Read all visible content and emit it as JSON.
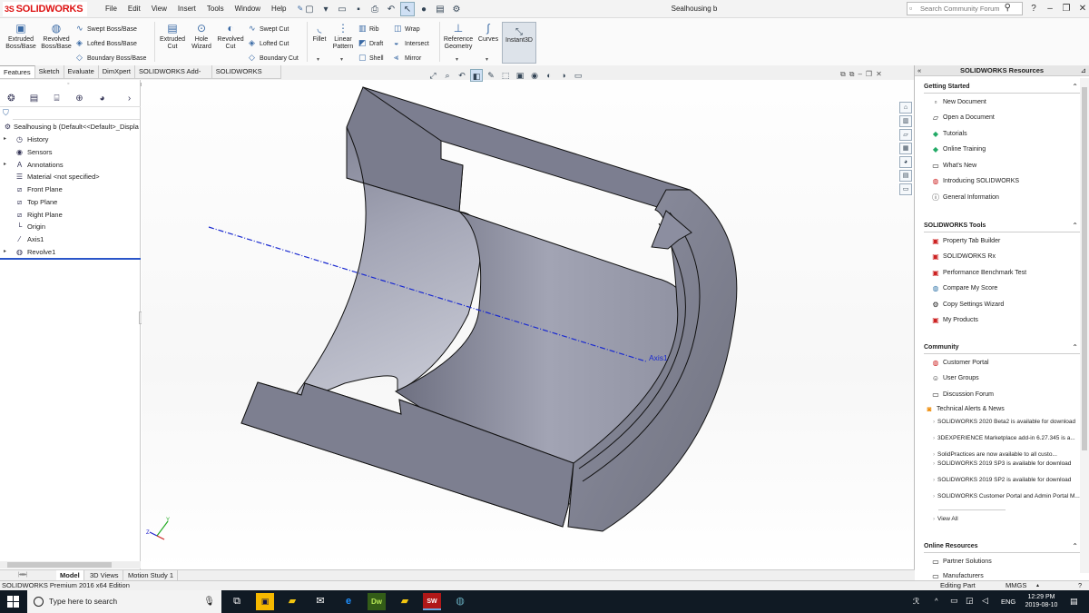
{
  "app": {
    "brand": "SOLIDWORKS",
    "document_title": "Sealhousing b",
    "menus": [
      "File",
      "Edit",
      "View",
      "Insert",
      "Tools",
      "Window",
      "Help"
    ],
    "search_placeholder": "Search Community Forum"
  },
  "ribbon": {
    "extruded_boss": "Extruded Boss/Base",
    "revolved_boss": "Revolved Boss/Base",
    "swept_boss": "Swept Boss/Base",
    "lofted_boss": "Lofted Boss/Base",
    "boundary_boss": "Boundary Boss/Base",
    "extruded_cut": "Extruded Cut",
    "hole_wizard": "Hole Wizard",
    "revolved_cut": "Revolved Cut",
    "swept_cut": "Swept Cut",
    "lofted_cut": "Lofted Cut",
    "boundary_cut": "Boundary Cut",
    "fillet": "Fillet",
    "linear_pattern": "Linear Pattern",
    "rib": "Rib",
    "draft": "Draft",
    "shell": "Shell",
    "wrap": "Wrap",
    "intersect": "Intersect",
    "mirror": "Mirror",
    "reference_geometry": "Reference Geometry",
    "curves": "Curves",
    "instant3d": "Instant3D"
  },
  "tabs": [
    "Features",
    "Sketch",
    "Evaluate",
    "DimXpert",
    "SOLIDWORKS Add-Ins",
    "SOLIDWORKS MBD"
  ],
  "tree": {
    "root": "Sealhousing b  (Default<<Default>_Displa",
    "items": [
      "History",
      "Sensors",
      "Annotations",
      "Material <not specified>",
      "Front Plane",
      "Top Plane",
      "Right Plane",
      "Origin",
      "Axis1",
      "Revolve1"
    ]
  },
  "viewport": {
    "axis_label": "Axis1"
  },
  "bottom_tabs": [
    "Model",
    "3D Views",
    "Motion Study 1"
  ],
  "status": {
    "edition": "SOLIDWORKS Premium 2016 x64 Edition",
    "mode": "Editing Part",
    "units": "MMGS"
  },
  "taskpane": {
    "title": "SOLIDWORKS Resources",
    "getting_started": {
      "title": "Getting Started",
      "items": [
        "New Document",
        "Open a Document",
        "Tutorials",
        "Online Training",
        "What's New",
        "Introducing SOLIDWORKS",
        "General Information"
      ]
    },
    "tools": {
      "title": "SOLIDWORKS Tools",
      "items": [
        "Property Tab Builder",
        "SOLIDWORKS Rx",
        "Performance Benchmark Test",
        "Compare My Score",
        "Copy Settings Wizard",
        "My Products"
      ]
    },
    "community": {
      "title": "Community",
      "items": [
        "Customer Portal",
        "User Groups",
        "Discussion Forum",
        "Technical Alerts & News"
      ]
    },
    "news": [
      "SOLIDWORKS 2020 Beta2 is available for download",
      "3DEXPERIENCE Marketplace add-in 6.27.345 is a...",
      "SolidPractices are now available to all custo...",
      "SOLIDWORKS 2019 SP3 is available for download",
      "SOLIDWORKS 2019 SP2 is available for download",
      "SOLIDWORKS Customer Portal and Admin Portal M..."
    ],
    "view_all": "View All",
    "online": {
      "title": "Online Resources",
      "items": [
        "Partner Solutions",
        "Manufacturers"
      ]
    }
  },
  "taskbar": {
    "search_placeholder": "Type here to search",
    "lang": "ENG",
    "time": "12:29 PM",
    "date": "2019-08-10"
  },
  "colors": {
    "part_face": "#8a8c9e",
    "part_dark": "#5e6072",
    "axis_line": "#1a2ad0",
    "brand_red": "#d11"
  }
}
